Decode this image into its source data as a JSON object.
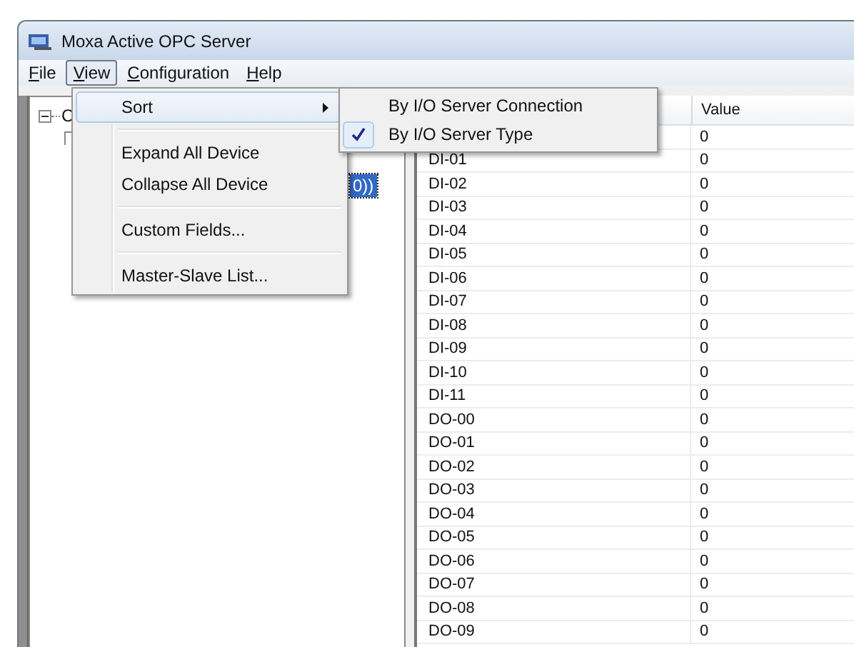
{
  "window": {
    "title": "Moxa Active OPC Server"
  },
  "menubar": [
    {
      "label": "File",
      "selected": false
    },
    {
      "label": "View",
      "selected": true
    },
    {
      "label": "Configuration",
      "selected": false
    },
    {
      "label": "Help",
      "selected": false
    }
  ],
  "tree": {
    "root_fragment": "C",
    "selected_fragment": "0))"
  },
  "list": {
    "value_header": "Value",
    "rows": [
      {
        "value": "0"
      },
      {
        "name": "DI-01",
        "value": "0"
      },
      {
        "name": "DI-02",
        "value": "0"
      },
      {
        "name": "DI-03",
        "value": "0"
      },
      {
        "name": "DI-04",
        "value": "0"
      },
      {
        "name": "DI-05",
        "value": "0"
      },
      {
        "name": "DI-06",
        "value": "0"
      },
      {
        "name": "DI-07",
        "value": "0"
      },
      {
        "name": "DI-08",
        "value": "0"
      },
      {
        "name": "DI-09",
        "value": "0"
      },
      {
        "name": "DI-10",
        "value": "0"
      },
      {
        "name": "DI-11",
        "value": "0"
      },
      {
        "name": "DO-00",
        "value": "0"
      },
      {
        "name": "DO-01",
        "value": "0"
      },
      {
        "name": "DO-02",
        "value": "0"
      },
      {
        "name": "DO-03",
        "value": "0"
      },
      {
        "name": "DO-04",
        "value": "0"
      },
      {
        "name": "DO-05",
        "value": "0"
      },
      {
        "name": "DO-06",
        "value": "0"
      },
      {
        "name": "DO-07",
        "value": "0"
      },
      {
        "name": "DO-08",
        "value": "0"
      },
      {
        "name": "DO-09",
        "value": "0"
      }
    ]
  },
  "view_menu": {
    "groups": [
      [
        {
          "label": "Sort",
          "kind": "submenu",
          "selected": true
        }
      ],
      [
        {
          "label": "Expand All Device",
          "kind": "item",
          "selected": false
        },
        {
          "label": "Collapse All Device",
          "kind": "item",
          "selected": false
        }
      ],
      [
        {
          "label": "Custom Fields...",
          "kind": "item",
          "selected": false
        }
      ],
      [
        {
          "label": "Master-Slave List...",
          "kind": "item",
          "selected": false
        }
      ]
    ]
  },
  "sort_submenu": [
    {
      "label": "By I/O Server Connection",
      "checked": false
    },
    {
      "label": "By I/O Server Type",
      "checked": true
    }
  ]
}
